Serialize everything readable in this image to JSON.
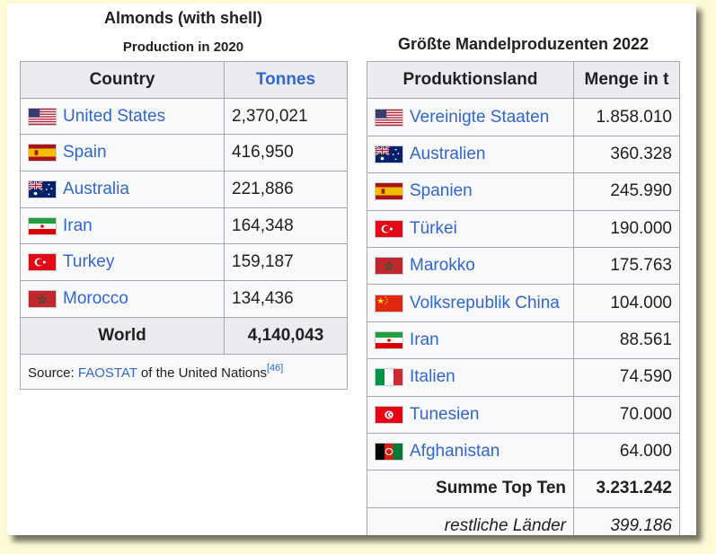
{
  "left_table": {
    "caption": "Almonds (with shell)",
    "subcaption": "Production in 2020",
    "headers": {
      "country": "Country",
      "tonnes": "Tonnes"
    },
    "rows": [
      {
        "country": "United States",
        "tonnes": "2,370,021",
        "flag": "flag-us-icon"
      },
      {
        "country": "Spain",
        "tonnes": "416,950",
        "flag": "flag-es-icon"
      },
      {
        "country": "Australia",
        "tonnes": "221,886",
        "flag": "flag-au-icon"
      },
      {
        "country": "Iran",
        "tonnes": "164,348",
        "flag": "flag-ir-icon"
      },
      {
        "country": "Turkey",
        "tonnes": "159,187",
        "flag": "flag-tr-icon"
      },
      {
        "country": "Morocco",
        "tonnes": "134,436",
        "flag": "flag-ma-icon"
      }
    ],
    "total": {
      "label": "World",
      "value": "4,140,043"
    },
    "source": {
      "prefix": "Source: ",
      "link": "FAOSTAT",
      "suffix": " of the United Nations",
      "ref": "[46]"
    }
  },
  "right_table": {
    "caption": "Größte Mandelproduzenten 2022",
    "headers": {
      "country": "Produktionsland",
      "amount": "Menge in t"
    },
    "rows": [
      {
        "country": "Vereinigte Staaten",
        "amount": "1.858.010",
        "flag": "flag-us-icon"
      },
      {
        "country": "Australien",
        "amount": "360.328",
        "flag": "flag-au-icon"
      },
      {
        "country": "Spanien",
        "amount": "245.990",
        "flag": "flag-es-icon"
      },
      {
        "country": "Türkei",
        "amount": "190.000",
        "flag": "flag-tr-icon"
      },
      {
        "country": "Marokko",
        "amount": "175.763",
        "flag": "flag-ma-icon"
      },
      {
        "country": "Volksrepublik China",
        "amount": "104.000",
        "flag": "flag-cn-icon"
      },
      {
        "country": "Iran",
        "amount": "88.561",
        "flag": "flag-ir-icon"
      },
      {
        "country": "Italien",
        "amount": "74.590",
        "flag": "flag-it-icon"
      },
      {
        "country": "Tunesien",
        "amount": "70.000",
        "flag": "flag-tn-icon"
      },
      {
        "country": "Afghanistan",
        "amount": "64.000",
        "flag": "flag-af-icon"
      }
    ],
    "total": {
      "label": "Summe Top Ten",
      "value": "3.231.242"
    },
    "rest": {
      "label": "restliche Länder",
      "value": "399.186"
    }
  },
  "colors": {
    "link": "#3366cc",
    "header_bg": "#eaecf0",
    "cell_bg": "#f8f9fa",
    "border": "#a2a9b1",
    "page_bg": "#fdfbd5"
  }
}
